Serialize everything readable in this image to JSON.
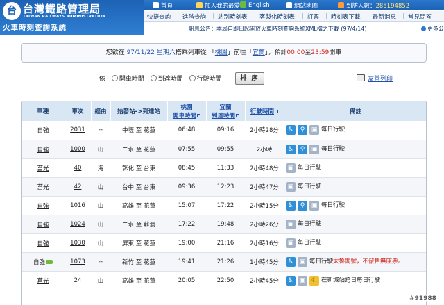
{
  "header": {
    "logo_mark": "台",
    "title": "台灣鐵路管理局",
    "title_en": "TAIWAN RAILWAYS ADMINISTRATION",
    "subtitle": "火車時刻查詢系統",
    "top_links": {
      "home": "首頁",
      "favorites": "加入我的最愛",
      "english": "English",
      "sitemap": "網站地圖",
      "visitors_label": "到訪人數：",
      "visitors_count": "285194852"
    },
    "nav": [
      "快捷查詢",
      "進階查詢",
      "站別時刻表",
      "客製化時刻表",
      "訂票",
      "時刻表下載",
      "最新消息",
      "常見問答"
    ],
    "notice": "訊息公告：本局自即日起開放火車時刻查詢系統XML檔之下載 (97/4/14)",
    "more_notices": "更多公告列表"
  },
  "summary": {
    "prefix": "您欲在",
    "date": "97/11/22",
    "weekday": "星期六",
    "text_from": "搭乘列車從",
    "origin": "桃園",
    "text_to": "前往",
    "destination": "宜蘭",
    "text_expect": "，預計",
    "time_start": "00:00",
    "text_until": "至",
    "time_end": "23:59",
    "suffix": "開車"
  },
  "sort": {
    "label": "依",
    "opt1": "開車時間",
    "opt2": "到達時間",
    "opt3": "行駛時間",
    "button": "排 序",
    "print": "友善列印"
  },
  "table": {
    "headers": {
      "type": "車種",
      "train_no": "車次",
      "via": "經由",
      "route": "始發站->到達站",
      "dep_station": "桃園",
      "dep_label": "開車時間",
      "arr_station": "宜蘭",
      "arr_label": "到達時間",
      "duration": "行駛時間",
      "notes": "備註"
    },
    "rows": [
      {
        "type": "自強",
        "train": "2031",
        "via": "--",
        "route": "中壢 至 花蓮",
        "dep": "06:48",
        "arr": "09:16",
        "dur": "2小時28分",
        "icons": [
          "wheel",
          "bike",
          "cart"
        ],
        "note": "每日行駛",
        "warn": "",
        "tag": false
      },
      {
        "type": "自強",
        "train": "1000",
        "via": "山",
        "route": "二水 至 花蓮",
        "dep": "07:55",
        "arr": "09:55",
        "dur": "2小時",
        "icons": [
          "wheel",
          "bike",
          "cart"
        ],
        "note": "每日行駛",
        "warn": "",
        "tag": false
      },
      {
        "type": "莒光",
        "train": "40",
        "via": "海",
        "route": "彰化 至 台東",
        "dep": "08:45",
        "arr": "11:33",
        "dur": "2小時48分",
        "icons": [
          "cart"
        ],
        "note": "每日行駛",
        "warn": "",
        "tag": false
      },
      {
        "type": "莒光",
        "train": "42",
        "via": "山",
        "route": "台中 至 台東",
        "dep": "09:36",
        "arr": "12:23",
        "dur": "2小時47分",
        "icons": [
          "cart"
        ],
        "note": "每日行駛",
        "warn": "",
        "tag": false
      },
      {
        "type": "自強",
        "train": "1016",
        "via": "山",
        "route": "高雄 至 花蓮",
        "dep": "15:07",
        "arr": "17:22",
        "dur": "2小時15分",
        "icons": [
          "wheel",
          "bike",
          "cart"
        ],
        "note": "每日行駛",
        "warn": "",
        "tag": false
      },
      {
        "type": "自強",
        "train": "1024",
        "via": "山",
        "route": "二水 至 蘇澳",
        "dep": "17:22",
        "arr": "19:48",
        "dur": "2小時26分",
        "icons": [
          "cart"
        ],
        "note": "每日行駛",
        "warn": "",
        "tag": false
      },
      {
        "type": "自強",
        "train": "1030",
        "via": "山",
        "route": "屏東 至 花蓮",
        "dep": "19:00",
        "arr": "21:16",
        "dur": "2小時16分",
        "icons": [
          "cart"
        ],
        "note": "每日行駛",
        "warn": "",
        "tag": false
      },
      {
        "type": "自強",
        "train": "1073",
        "via": "--",
        "route": "新竹 至 花蓮",
        "dep": "19:41",
        "arr": "21:26",
        "dur": "1小時45分",
        "icons": [
          "wheel",
          "cart"
        ],
        "note": "每日行駛",
        "warn": "太魯閣號，不發售無座票。",
        "tag": true
      },
      {
        "type": "莒光",
        "train": "24",
        "via": "山",
        "route": "高雄 至 花蓮",
        "dep": "20:05",
        "arr": "22:50",
        "dur": "2小時45分",
        "icons": [
          "wheel",
          "cart",
          "moon"
        ],
        "note": "在新城站跨日每日行駛",
        "warn": "",
        "tag": false
      }
    ]
  },
  "watermark": "#91988",
  "colors": {
    "brand_blue": "#1d62b5",
    "header_bg": "#d9e6f4",
    "accent_red": "#d0241c",
    "link_blue": "#2050a8"
  }
}
